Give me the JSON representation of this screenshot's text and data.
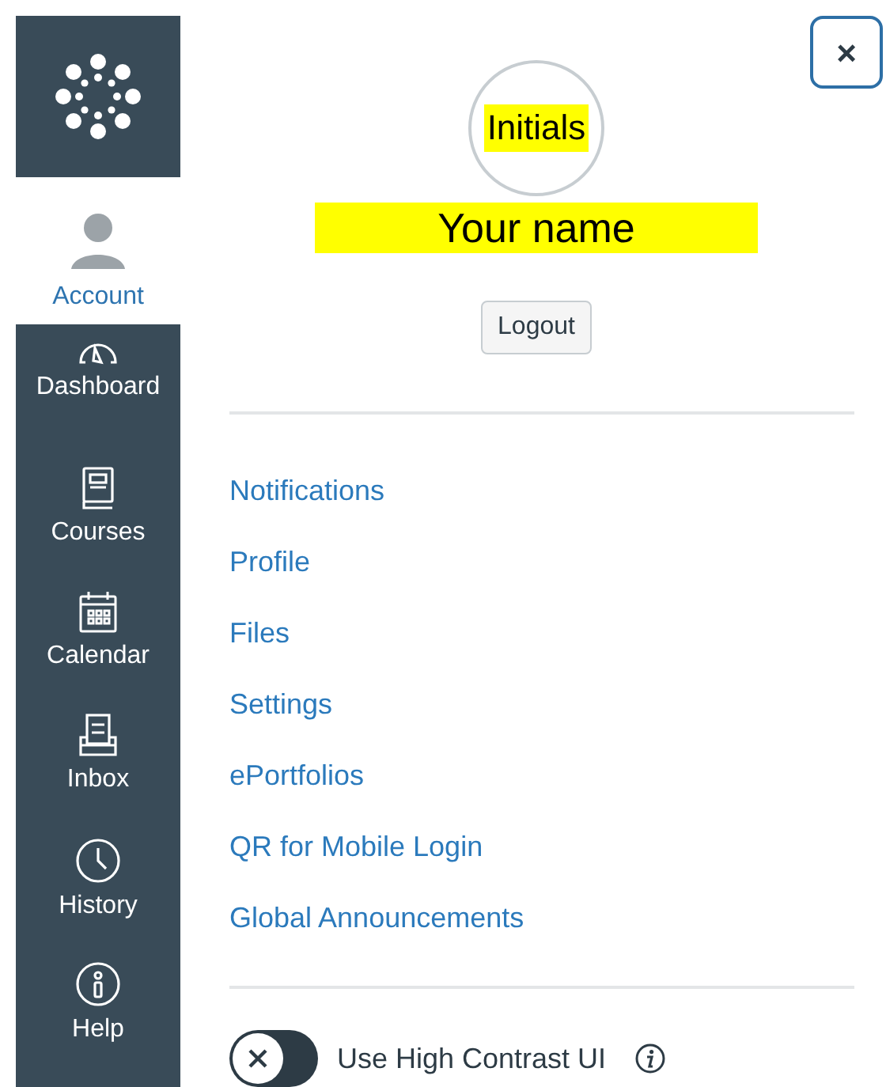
{
  "sidebar": {
    "items": [
      {
        "label": "Account",
        "selected": true
      },
      {
        "label": "Dashboard",
        "selected": false
      },
      {
        "label": "Courses",
        "selected": false
      },
      {
        "label": "Calendar",
        "selected": false
      },
      {
        "label": "Inbox",
        "selected": false
      },
      {
        "label": "History",
        "selected": false
      },
      {
        "label": "Help",
        "selected": false
      }
    ]
  },
  "close_button": {
    "label": "×"
  },
  "profile": {
    "initials": "Initials",
    "name": "Your name",
    "logout": "Logout"
  },
  "links": [
    "Notifications",
    "Profile",
    "Files",
    "Settings",
    "ePortfolios",
    "QR for Mobile Login",
    "Global Announcements"
  ],
  "high_contrast": {
    "label": "Use High Contrast UI",
    "on": false
  }
}
